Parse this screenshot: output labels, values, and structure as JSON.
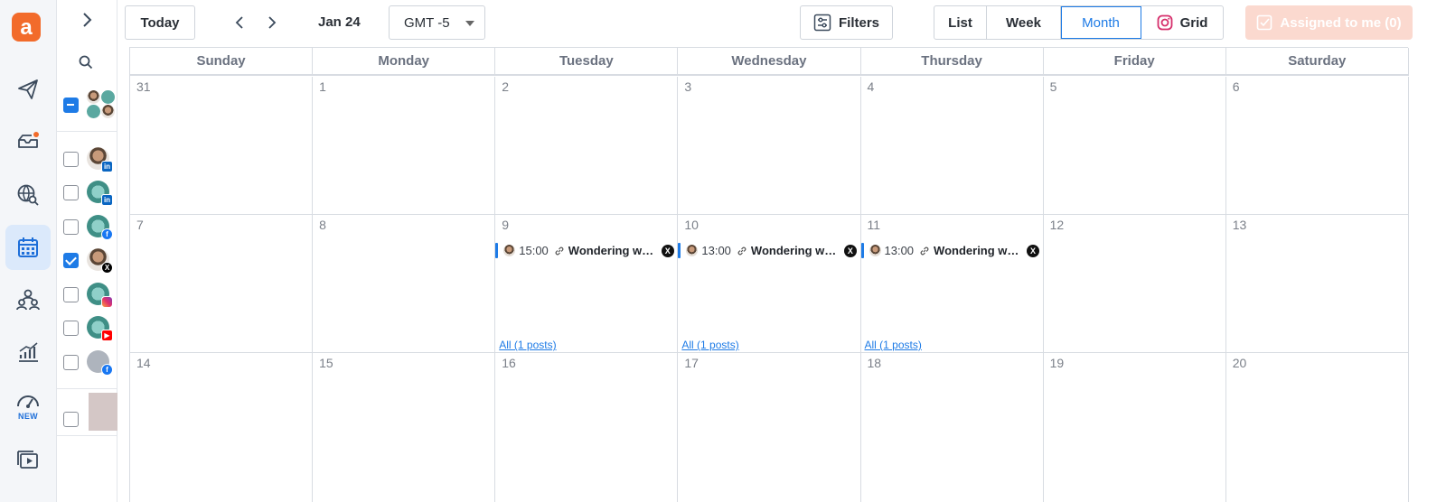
{
  "rail": {
    "items": [
      {
        "name": "publish",
        "label": ""
      },
      {
        "name": "inbox",
        "label": ""
      },
      {
        "name": "listening",
        "label": ""
      },
      {
        "name": "calendar",
        "label": ""
      },
      {
        "name": "team",
        "label": ""
      },
      {
        "name": "analytics",
        "label": ""
      },
      {
        "name": "dashboard",
        "label": "NEW"
      },
      {
        "name": "media",
        "label": ""
      }
    ]
  },
  "toolbar": {
    "today_label": "Today",
    "date_label": "Jan 24",
    "timezone": "GMT -5",
    "filters_label": "Filters",
    "views": [
      "List",
      "Week",
      "Month",
      "Grid"
    ],
    "active_view": "Month",
    "assigned_label": "Assigned to me (0)"
  },
  "calendar": {
    "weekdays": [
      "Sunday",
      "Monday",
      "Tuesday",
      "Wednesday",
      "Thursday",
      "Friday",
      "Saturday"
    ],
    "weeks": [
      [
        "31",
        "1",
        "2",
        "3",
        "4",
        "5",
        "6"
      ],
      [
        "7",
        "8",
        "9",
        "10",
        "11",
        "12",
        "13"
      ],
      [
        "14",
        "15",
        "16",
        "17",
        "18",
        "19",
        "20"
      ]
    ],
    "posts": {
      "tue": {
        "time": "15:00",
        "title": "Wondering wh…",
        "all": "All (1 posts)"
      },
      "wed": {
        "time": "13:00",
        "title": "Wondering wh…",
        "all": "All (1 posts)"
      },
      "thu": {
        "time": "13:00",
        "title": "Wondering wh…",
        "all": "All (1 posts)"
      }
    }
  },
  "colors": {
    "accent": "#1e7be6",
    "brand": "#f26b2b",
    "assigned_bg": "#fbd9cf"
  }
}
